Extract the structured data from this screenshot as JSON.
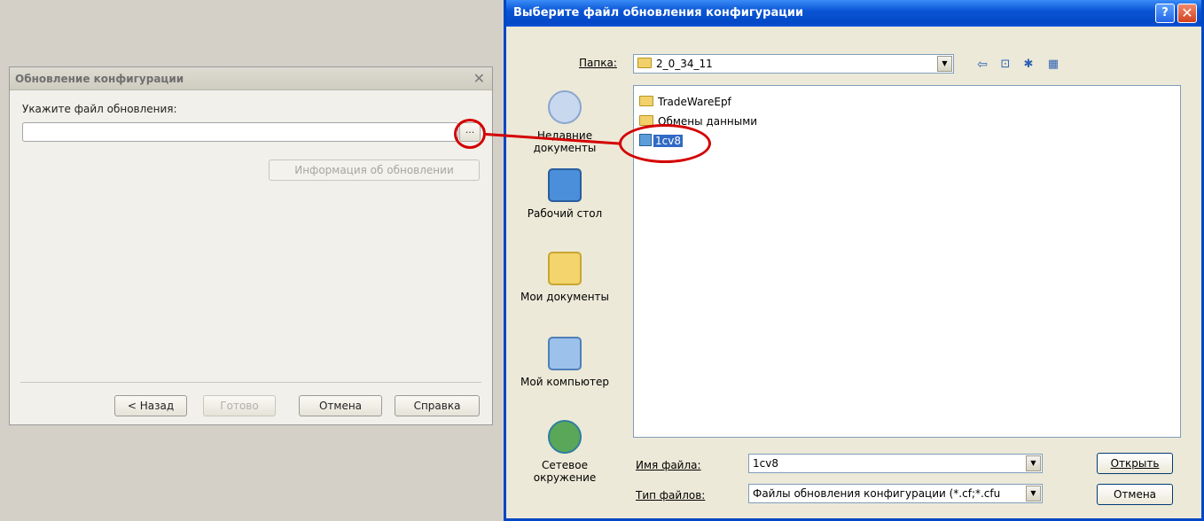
{
  "config_dialog": {
    "title": "Обновление конфигурации",
    "close_glyph": "✕",
    "file_label": "Укажите файл обновления:",
    "file_value": "",
    "browse_label": "...",
    "info_button": "Информация об обновлении",
    "buttons": {
      "back": "< Назад",
      "done": "Готово",
      "cancel": "Отмена",
      "help": "Справка"
    }
  },
  "file_dialog": {
    "title": "Выберите файл обновления конфигурации",
    "help_glyph": "?",
    "close_glyph": "✕",
    "folder_label": "Папка:",
    "folder_value": "2_0_34_11",
    "places": [
      {
        "label": "Недавние документы",
        "icon": "recent-documents-icon"
      },
      {
        "label": "Рабочий стол",
        "icon": "desktop-icon"
      },
      {
        "label": "Мои документы",
        "icon": "my-documents-icon"
      },
      {
        "label": "Мой компьютер",
        "icon": "my-computer-icon"
      },
      {
        "label": "Сетевое окружение",
        "icon": "network-icon"
      }
    ],
    "files": [
      {
        "name": "TradeWareEpf",
        "type": "folder"
      },
      {
        "name": "Обмены данными",
        "type": "folder"
      },
      {
        "name": "1cv8",
        "type": "file",
        "selected": true
      }
    ],
    "filename_label": "Имя файла:",
    "filename_value": "1cv8",
    "filetype_label": "Тип файлов:",
    "filetype_value": "Файлы обновления конфигурации (*.cf;*.cfu",
    "open_button": "Открыть",
    "cancel_button": "Отмена"
  },
  "colors": {
    "annotation": "#d40000",
    "xp_title": "#0a56d6",
    "selection": "#316ac5"
  }
}
